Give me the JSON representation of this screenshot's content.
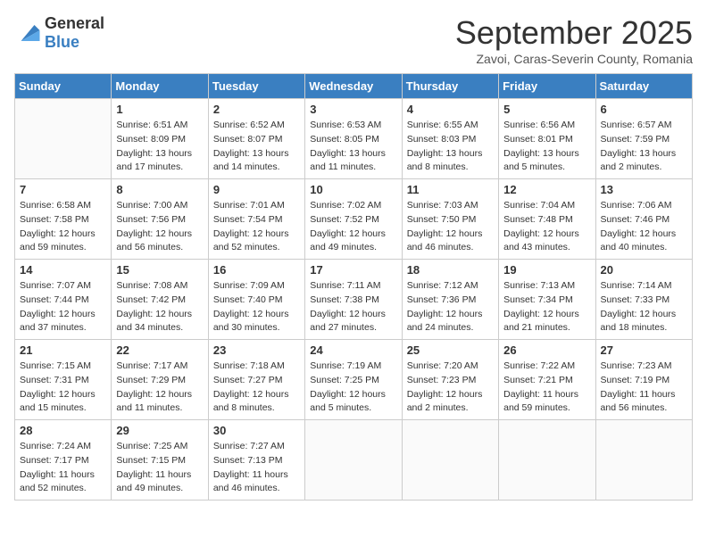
{
  "header": {
    "logo_general": "General",
    "logo_blue": "Blue",
    "month_title": "September 2025",
    "subtitle": "Zavoi, Caras-Severin County, Romania"
  },
  "weekdays": [
    "Sunday",
    "Monday",
    "Tuesday",
    "Wednesday",
    "Thursday",
    "Friday",
    "Saturday"
  ],
  "weeks": [
    [
      {
        "day": "",
        "sunrise": "",
        "sunset": "",
        "daylight": ""
      },
      {
        "day": "1",
        "sunrise": "Sunrise: 6:51 AM",
        "sunset": "Sunset: 8:09 PM",
        "daylight": "Daylight: 13 hours and 17 minutes."
      },
      {
        "day": "2",
        "sunrise": "Sunrise: 6:52 AM",
        "sunset": "Sunset: 8:07 PM",
        "daylight": "Daylight: 13 hours and 14 minutes."
      },
      {
        "day": "3",
        "sunrise": "Sunrise: 6:53 AM",
        "sunset": "Sunset: 8:05 PM",
        "daylight": "Daylight: 13 hours and 11 minutes."
      },
      {
        "day": "4",
        "sunrise": "Sunrise: 6:55 AM",
        "sunset": "Sunset: 8:03 PM",
        "daylight": "Daylight: 13 hours and 8 minutes."
      },
      {
        "day": "5",
        "sunrise": "Sunrise: 6:56 AM",
        "sunset": "Sunset: 8:01 PM",
        "daylight": "Daylight: 13 hours and 5 minutes."
      },
      {
        "day": "6",
        "sunrise": "Sunrise: 6:57 AM",
        "sunset": "Sunset: 7:59 PM",
        "daylight": "Daylight: 13 hours and 2 minutes."
      }
    ],
    [
      {
        "day": "7",
        "sunrise": "Sunrise: 6:58 AM",
        "sunset": "Sunset: 7:58 PM",
        "daylight": "Daylight: 12 hours and 59 minutes."
      },
      {
        "day": "8",
        "sunrise": "Sunrise: 7:00 AM",
        "sunset": "Sunset: 7:56 PM",
        "daylight": "Daylight: 12 hours and 56 minutes."
      },
      {
        "day": "9",
        "sunrise": "Sunrise: 7:01 AM",
        "sunset": "Sunset: 7:54 PM",
        "daylight": "Daylight: 12 hours and 52 minutes."
      },
      {
        "day": "10",
        "sunrise": "Sunrise: 7:02 AM",
        "sunset": "Sunset: 7:52 PM",
        "daylight": "Daylight: 12 hours and 49 minutes."
      },
      {
        "day": "11",
        "sunrise": "Sunrise: 7:03 AM",
        "sunset": "Sunset: 7:50 PM",
        "daylight": "Daylight: 12 hours and 46 minutes."
      },
      {
        "day": "12",
        "sunrise": "Sunrise: 7:04 AM",
        "sunset": "Sunset: 7:48 PM",
        "daylight": "Daylight: 12 hours and 43 minutes."
      },
      {
        "day": "13",
        "sunrise": "Sunrise: 7:06 AM",
        "sunset": "Sunset: 7:46 PM",
        "daylight": "Daylight: 12 hours and 40 minutes."
      }
    ],
    [
      {
        "day": "14",
        "sunrise": "Sunrise: 7:07 AM",
        "sunset": "Sunset: 7:44 PM",
        "daylight": "Daylight: 12 hours and 37 minutes."
      },
      {
        "day": "15",
        "sunrise": "Sunrise: 7:08 AM",
        "sunset": "Sunset: 7:42 PM",
        "daylight": "Daylight: 12 hours and 34 minutes."
      },
      {
        "day": "16",
        "sunrise": "Sunrise: 7:09 AM",
        "sunset": "Sunset: 7:40 PM",
        "daylight": "Daylight: 12 hours and 30 minutes."
      },
      {
        "day": "17",
        "sunrise": "Sunrise: 7:11 AM",
        "sunset": "Sunset: 7:38 PM",
        "daylight": "Daylight: 12 hours and 27 minutes."
      },
      {
        "day": "18",
        "sunrise": "Sunrise: 7:12 AM",
        "sunset": "Sunset: 7:36 PM",
        "daylight": "Daylight: 12 hours and 24 minutes."
      },
      {
        "day": "19",
        "sunrise": "Sunrise: 7:13 AM",
        "sunset": "Sunset: 7:34 PM",
        "daylight": "Daylight: 12 hours and 21 minutes."
      },
      {
        "day": "20",
        "sunrise": "Sunrise: 7:14 AM",
        "sunset": "Sunset: 7:33 PM",
        "daylight": "Daylight: 12 hours and 18 minutes."
      }
    ],
    [
      {
        "day": "21",
        "sunrise": "Sunrise: 7:15 AM",
        "sunset": "Sunset: 7:31 PM",
        "daylight": "Daylight: 12 hours and 15 minutes."
      },
      {
        "day": "22",
        "sunrise": "Sunrise: 7:17 AM",
        "sunset": "Sunset: 7:29 PM",
        "daylight": "Daylight: 12 hours and 11 minutes."
      },
      {
        "day": "23",
        "sunrise": "Sunrise: 7:18 AM",
        "sunset": "Sunset: 7:27 PM",
        "daylight": "Daylight: 12 hours and 8 minutes."
      },
      {
        "day": "24",
        "sunrise": "Sunrise: 7:19 AM",
        "sunset": "Sunset: 7:25 PM",
        "daylight": "Daylight: 12 hours and 5 minutes."
      },
      {
        "day": "25",
        "sunrise": "Sunrise: 7:20 AM",
        "sunset": "Sunset: 7:23 PM",
        "daylight": "Daylight: 12 hours and 2 minutes."
      },
      {
        "day": "26",
        "sunrise": "Sunrise: 7:22 AM",
        "sunset": "Sunset: 7:21 PM",
        "daylight": "Daylight: 11 hours and 59 minutes."
      },
      {
        "day": "27",
        "sunrise": "Sunrise: 7:23 AM",
        "sunset": "Sunset: 7:19 PM",
        "daylight": "Daylight: 11 hours and 56 minutes."
      }
    ],
    [
      {
        "day": "28",
        "sunrise": "Sunrise: 7:24 AM",
        "sunset": "Sunset: 7:17 PM",
        "daylight": "Daylight: 11 hours and 52 minutes."
      },
      {
        "day": "29",
        "sunrise": "Sunrise: 7:25 AM",
        "sunset": "Sunset: 7:15 PM",
        "daylight": "Daylight: 11 hours and 49 minutes."
      },
      {
        "day": "30",
        "sunrise": "Sunrise: 7:27 AM",
        "sunset": "Sunset: 7:13 PM",
        "daylight": "Daylight: 11 hours and 46 minutes."
      },
      {
        "day": "",
        "sunrise": "",
        "sunset": "",
        "daylight": ""
      },
      {
        "day": "",
        "sunrise": "",
        "sunset": "",
        "daylight": ""
      },
      {
        "day": "",
        "sunrise": "",
        "sunset": "",
        "daylight": ""
      },
      {
        "day": "",
        "sunrise": "",
        "sunset": "",
        "daylight": ""
      }
    ]
  ]
}
